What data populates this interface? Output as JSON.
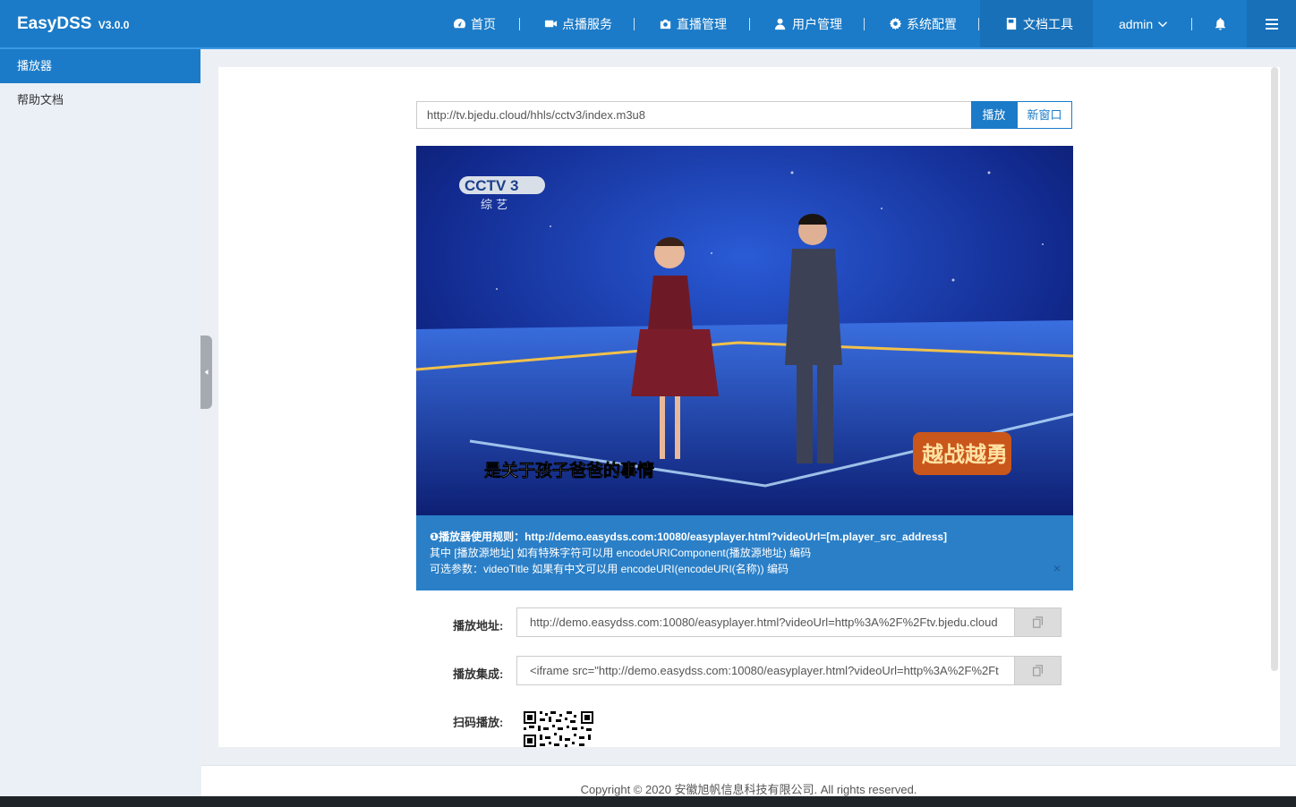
{
  "header": {
    "app_name": "EasyDSS",
    "version": "V3.0.0",
    "nav": [
      {
        "label": "首页",
        "icon": "dashboard-icon"
      },
      {
        "label": "点播服务",
        "icon": "video-camera-icon"
      },
      {
        "label": "直播管理",
        "icon": "live-camera-icon"
      },
      {
        "label": "用户管理",
        "icon": "user-icon"
      },
      {
        "label": "系统配置",
        "icon": "gear-icon"
      },
      {
        "label": "文档工具",
        "icon": "book-icon"
      }
    ],
    "user": "admin",
    "active_nav": "文档工具"
  },
  "sidebar": {
    "items": [
      {
        "label": "播放器",
        "active": true
      },
      {
        "label": "帮助文档",
        "active": false
      }
    ]
  },
  "player": {
    "url_value": "http://tv.bjedu.cloud/hhls/cctv3/index.m3u8",
    "play_label": "播放",
    "new_window_label": "新窗口",
    "video": {
      "channel_logo": "CCTV 3",
      "channel_sub": "综 艺",
      "subtitle": "是关于孩子爸爸的事情",
      "show_logo": "越战越勇"
    },
    "info": {
      "line1": "❶播放器使用规则：http://demo.easydss.com:10080/easyplayer.html?videoUrl=[m.player_src_address]",
      "line2": "其中 [播放源地址] 如有特殊字符可以用 encodeURIComponent(播放源地址) 编码",
      "line3": "可选参数：videoTitle 如果有中文可以用 encodeURI(encodeURI(名称)) 编码",
      "close": "×"
    },
    "play_address_label": "播放地址:",
    "play_address_value": "http://demo.easydss.com:10080/easyplayer.html?videoUrl=http%3A%2F%2Ftv.bjedu.cloud",
    "embed_label": "播放集成:",
    "embed_value": "<iframe src=\"http://demo.easydss.com:10080/easyplayer.html?videoUrl=http%3A%2F%2Ft",
    "qr_label": "扫码播放:"
  },
  "footer": {
    "copyright": "Copyright © 2020 安徽旭帆信息科技有限公司. All rights reserved."
  },
  "colors": {
    "primary": "#1b7bc8",
    "info_bg": "#2a7fc7",
    "sidebar_bg": "#eaf0f6"
  }
}
